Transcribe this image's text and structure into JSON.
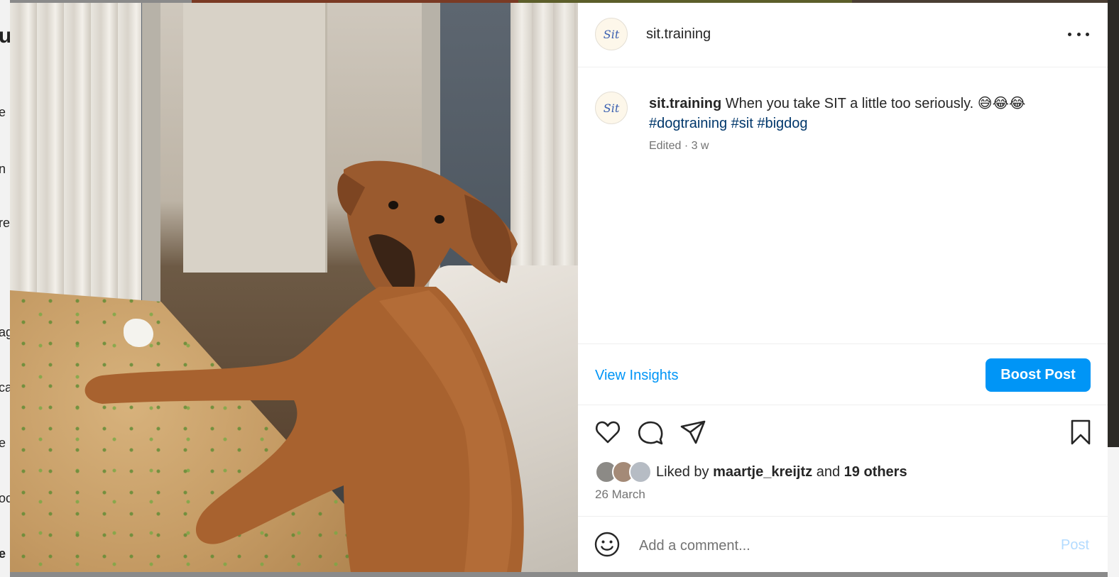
{
  "background": {
    "left_fragments": [
      "u",
      "e",
      "n",
      "re",
      "ag",
      "ca",
      "e",
      "oc",
      "e"
    ]
  },
  "post": {
    "username": "sit.training",
    "avatar_text": "Sit",
    "caption_text": "When you take SIT a little too seriously. 😅😂😂",
    "hashtags": [
      "#dogtraining",
      "#sit",
      "#bigdog"
    ],
    "meta": "Edited · 3 w",
    "view_insights": "View Insights",
    "boost_post": "Boost Post",
    "liked_by_prefix": "Liked by",
    "liked_by_user": "maartje_kreijtz",
    "liked_by_and": "and",
    "liked_by_others": "19 others",
    "date": "26 March",
    "comment_placeholder": "Add a comment...",
    "post_button": "Post"
  },
  "icons": {
    "more": "more-options-icon",
    "like": "heart-icon",
    "comment": "comment-icon",
    "share": "send-icon",
    "save": "bookmark-icon",
    "emoji": "emoji-icon"
  },
  "colors": {
    "accent": "#0095f6",
    "hashtag": "#00376b",
    "muted": "#737373",
    "post_disabled": "#b3dbff"
  }
}
